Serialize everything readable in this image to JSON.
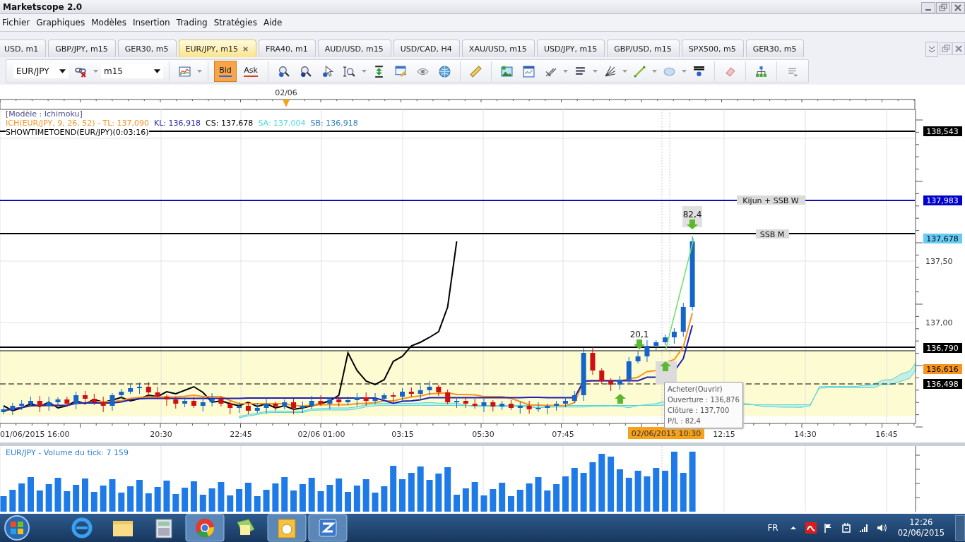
{
  "window": {
    "title": "Marketscope 2.0"
  },
  "menu": [
    {
      "label": "Fichier"
    },
    {
      "label": "Graphiques"
    },
    {
      "label": "Modèles"
    },
    {
      "label": "Insertion"
    },
    {
      "label": "Trading"
    },
    {
      "label": "Stratégies"
    },
    {
      "label": "Aide"
    }
  ],
  "tabs": [
    {
      "label": "USD, m1",
      "selected": false
    },
    {
      "label": "GBP/JPY, m15",
      "selected": false
    },
    {
      "label": "GER30, m5",
      "selected": false
    },
    {
      "label": "EUR/JPY, m15",
      "selected": true
    },
    {
      "label": "FRA40, m1",
      "selected": false
    },
    {
      "label": "AUD/USD, m15",
      "selected": false
    },
    {
      "label": "USD/CAD, H4",
      "selected": false
    },
    {
      "label": "XAU/USD, m15",
      "selected": false
    },
    {
      "label": "USD/JPY, m15",
      "selected": false
    },
    {
      "label": "GBP/USD, m15",
      "selected": false
    },
    {
      "label": "SPX500, m5",
      "selected": false
    },
    {
      "label": "GER30, m5",
      "selected": false
    }
  ],
  "toolbar": {
    "symbol": "EUR/JPY",
    "period": "m15",
    "price_modes": [
      {
        "label": "Bid",
        "selected": true
      },
      {
        "label": "Ask",
        "selected": false
      }
    ]
  },
  "chart": {
    "date_marker": "02/06",
    "legend": {
      "model": "[Modèle : Ichimoku]",
      "items": [
        {
          "text": "ICH(EUR/JPY, 9, 26, 52) -  TL: 137,090",
          "color": "#f7941d"
        },
        {
          "text": "KL: 136,918",
          "color": "#1f1fa8"
        },
        {
          "text": "CS: 137,678",
          "color": "#000000"
        },
        {
          "text": "SA: 137,004",
          "color": "#4dd9d9"
        },
        {
          "text": "SB: 136,918",
          "color": "#2a7fbf"
        }
      ],
      "timer": "SHOWTIMETOEND(EUR/JPY)(0:03:16)"
    },
    "line_labels": [
      {
        "text": "Kijun + SSB W"
      },
      {
        "text": "SSB M"
      }
    ],
    "price_tags": [
      {
        "text": "138,543",
        "color": "#000000"
      },
      {
        "text": "137,983",
        "color": "#0000cc"
      },
      {
        "text": "137,678",
        "color": "#66ccf5"
      },
      {
        "text": "136,790",
        "color": "#000000"
      },
      {
        "text": "136,616",
        "color": "#f7941d"
      },
      {
        "text": "136,498",
        "color": "#000000"
      }
    ],
    "y_ticks": [
      "137,50",
      "137,00"
    ],
    "trade_labels": [
      "20,1",
      "82,4"
    ],
    "tooltip": {
      "title": "Acheter(Ouvrir)",
      "lines": [
        "Ouverture : 136,876",
        "Clôture : 137,700",
        "P/L : 82,4"
      ]
    },
    "x_ticks": [
      "01/06/2015 16:00",
      "20:30",
      "22:45",
      "02/06 01:00",
      "03:15",
      "05:30",
      "07:45",
      "12:15",
      "14:30",
      "16:45"
    ],
    "cursor_time": "02/06/2015 10:30"
  },
  "volume": {
    "title": "EUR/JPY - Volume du tick: 7 159"
  },
  "taskbar": {
    "language": "FR",
    "time": "12:26",
    "date": "02/06/2015"
  }
}
